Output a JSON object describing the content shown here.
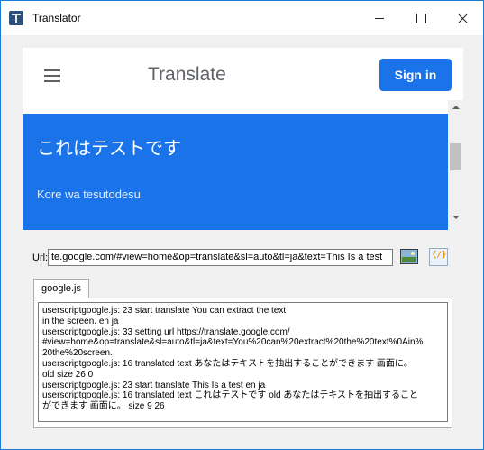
{
  "window": {
    "title": "Translator",
    "app_icon": "translator-app-icon",
    "controls": [
      "minimize-icon",
      "maximize-icon",
      "close-icon"
    ]
  },
  "webpage": {
    "brand": "Translate",
    "sign_in_label": "Sign in",
    "translated_text": "これはテストです",
    "romanization": "Kore wa tesutodesu",
    "accent_color": "#1a73e8"
  },
  "url_bar": {
    "label": "Url:",
    "value": "te.google.com/#view=home&op=translate&sl=auto&tl=ja&text=This Is a test"
  },
  "toolbar": {
    "capture_icon": "screen-capture-icon",
    "script_icon": "userscript-icon"
  },
  "tabs": [
    {
      "label": "google.js",
      "selected": true
    }
  ],
  "log": {
    "lines": [
      "userscriptgoogle.js: 23 start translate You can extract the text",
      "in the screen. en ja",
      "userscriptgoogle.js: 33 setting url https://translate.google.com/",
      "#view=home&op=translate&sl=auto&tl=ja&text=You%20can%20extract%20the%20text%0Ain%",
      "20the%20screen.",
      "userscriptgoogle.js: 16 translated text  あなたはテキストを抽出することができます 画面に。",
      "old  size 26 0",
      "userscriptgoogle.js: 23 start translate This Is a test en ja",
      "userscriptgoogle.js: 16 translated text  これはテストです old  あなたはテキストを抽出すること",
      "ができます 画面に。 size 9 26"
    ]
  }
}
